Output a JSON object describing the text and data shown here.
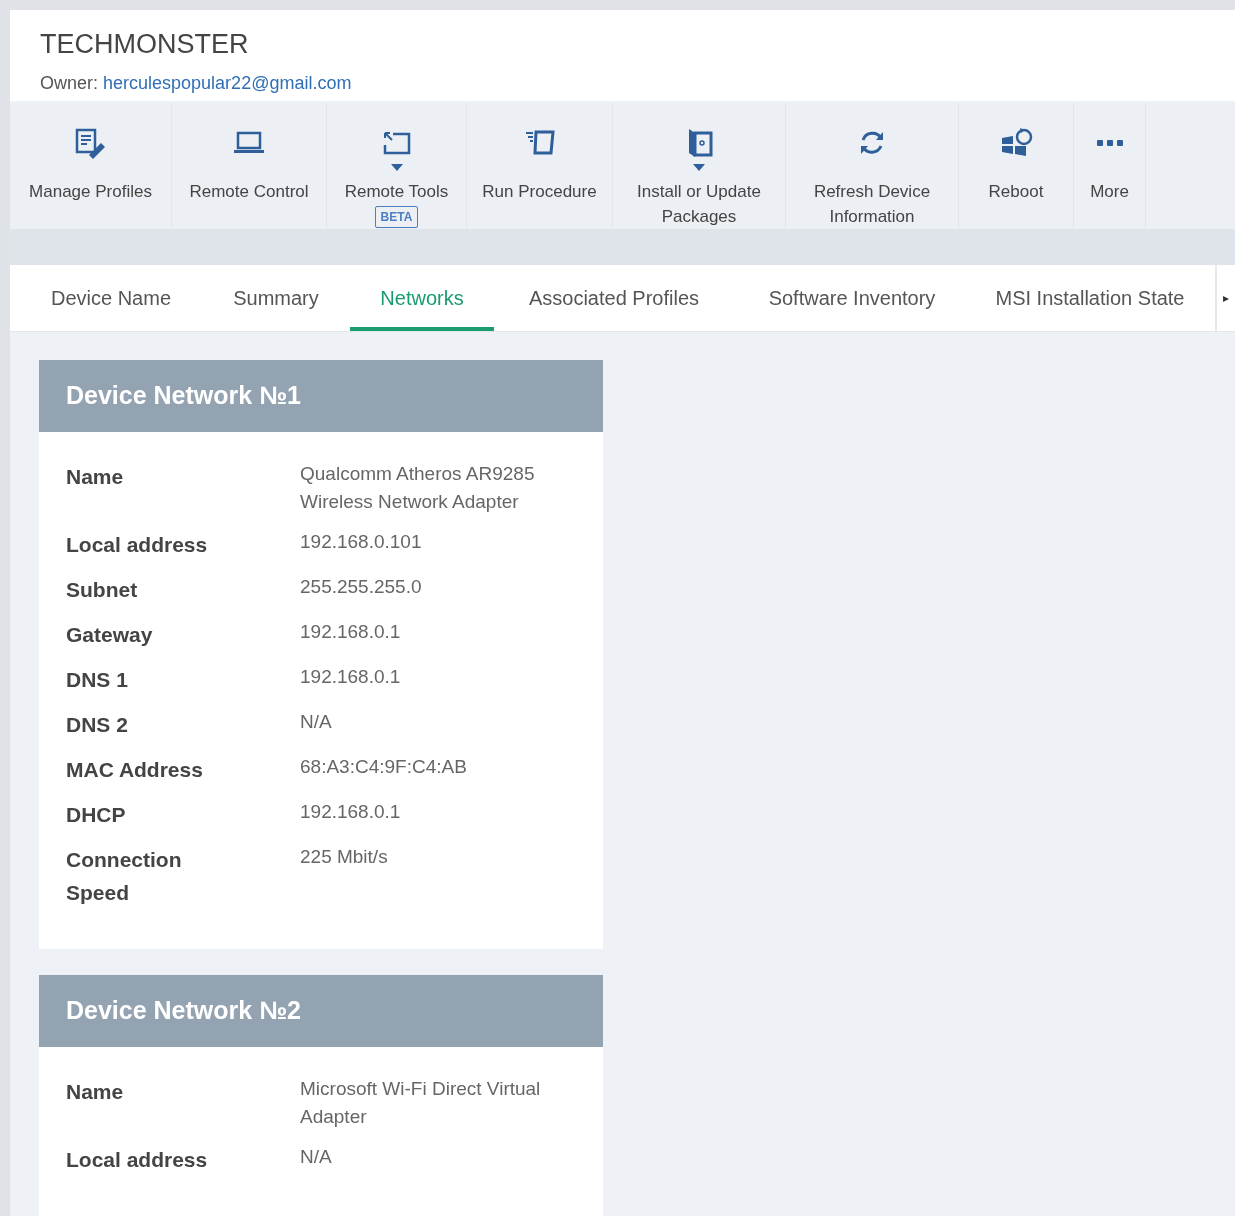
{
  "header": {
    "title": "TECHMONSTER",
    "owner_label": "Owner:",
    "owner_email": "herculespopular22@gmail.com"
  },
  "toolbar": [
    {
      "kind": "profiles",
      "label": "Manage Profiles",
      "dropdown": false
    },
    {
      "kind": "laptop",
      "label": "Remote Control",
      "dropdown": false
    },
    {
      "kind": "tools",
      "label": "Remote Tools",
      "dropdown": true,
      "badge": "BETA"
    },
    {
      "kind": "procedure",
      "label": "Run Procedure",
      "dropdown": false
    },
    {
      "kind": "package",
      "label": "Install or Update Packages",
      "dropdown": true
    },
    {
      "kind": "refresh",
      "label": "Refresh Device Information",
      "dropdown": false
    },
    {
      "kind": "reboot",
      "label": "Reboot",
      "dropdown": false
    },
    {
      "kind": "more",
      "label": "More",
      "dropdown": false
    }
  ],
  "tabs": [
    {
      "label": "Device Name",
      "selected": false
    },
    {
      "label": "Summary",
      "selected": false
    },
    {
      "label": "Networks",
      "selected": true
    },
    {
      "label": "Associated Profiles",
      "selected": false
    },
    {
      "label": "Software Inventory",
      "selected": false
    },
    {
      "label": "MSI Installation State",
      "selected": false
    }
  ],
  "tab_scroll": "▸",
  "networks": [
    {
      "title": "Device Network №1",
      "rows": [
        {
          "label": "Name",
          "value": "Qualcomm Atheros AR9285 Wireless Network Adapter"
        },
        {
          "label": "Local address",
          "value": "192.168.0.101"
        },
        {
          "label": "Subnet",
          "value": "255.255.255.0"
        },
        {
          "label": "Gateway",
          "value": "192.168.0.1"
        },
        {
          "label": "DNS 1",
          "value": "192.168.0.1"
        },
        {
          "label": "DNS 2",
          "value": "N/A"
        },
        {
          "label": "MAC Address",
          "value": "68:A3:C4:9F:C4:AB"
        },
        {
          "label": "DHCP",
          "value": "192.168.0.1"
        },
        {
          "label": "Connection Speed",
          "value": "225 Mbit/s"
        }
      ]
    },
    {
      "title": "Device Network №2",
      "rows": [
        {
          "label": "Name",
          "value": "Microsoft Wi-Fi Direct Virtual Adapter"
        },
        {
          "label": "Local address",
          "value": "N/A"
        }
      ]
    }
  ]
}
